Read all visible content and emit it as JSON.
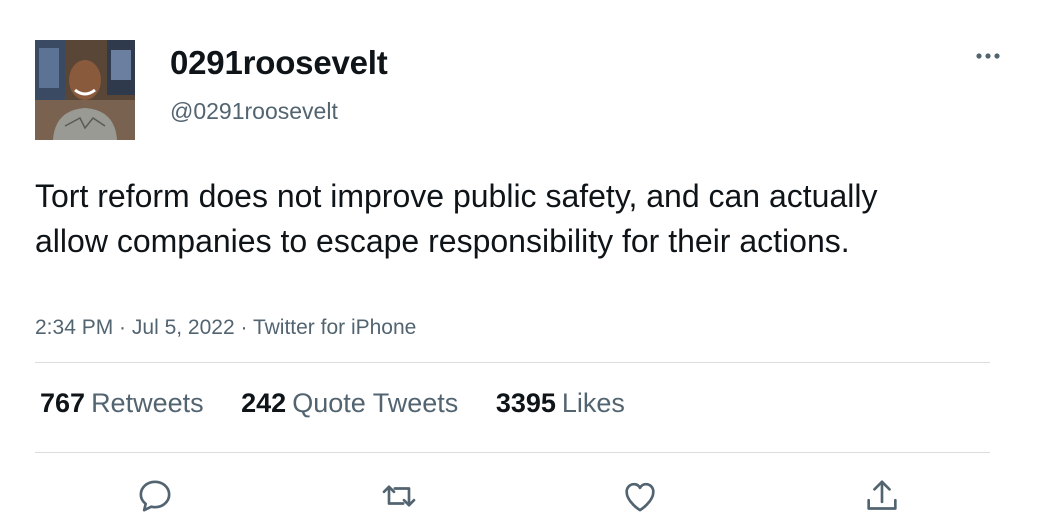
{
  "user": {
    "display_name": "0291roosevelt",
    "handle": "@0291roosevelt"
  },
  "tweet": {
    "text": "Tort reform does not improve public safety, and can actually allow companies to escape responsibility for their actions.",
    "time": "2:34 PM",
    "date": "Jul 5, 2022",
    "source": "Twitter for iPhone",
    "separator": " · "
  },
  "stats": {
    "retweets": {
      "count": "767",
      "label": "Retweets"
    },
    "quotes": {
      "count": "242",
      "label": "Quote Tweets"
    },
    "likes": {
      "count": "3395",
      "label": "Likes"
    }
  },
  "icons": {
    "more": "more-horizontal-icon",
    "reply": "reply-icon",
    "retweet": "retweet-icon",
    "like": "heart-icon",
    "share": "share-icon"
  },
  "colors": {
    "text_primary": "#0f1419",
    "text_secondary": "#536471",
    "divider": "#d9dde0"
  }
}
